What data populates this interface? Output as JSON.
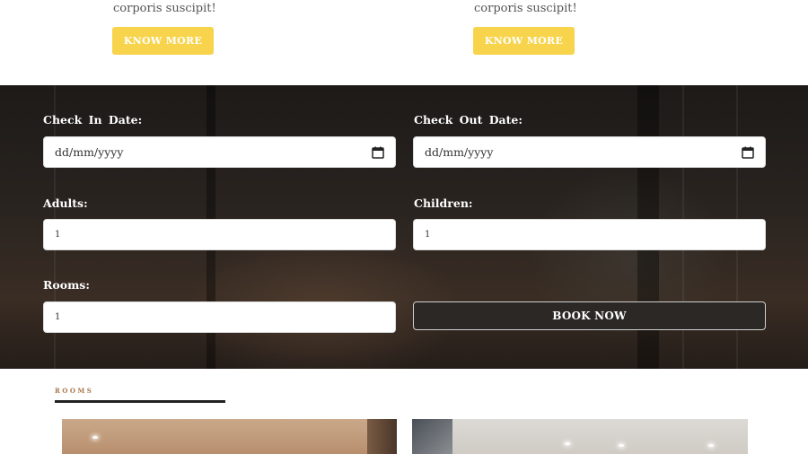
{
  "cards": [
    {
      "text_tail": "corporis suscipit!",
      "button": "KNOW MORE"
    },
    {
      "text_tail": "corporis suscipit!",
      "button": "KNOW MORE"
    }
  ],
  "booking": {
    "check_in_label": "Check In Date:",
    "check_in_placeholder": "dd/mm/yyyy",
    "check_out_label": "Check Out Date:",
    "check_out_placeholder": "dd/mm/yyyy",
    "adults_label": "Adults:",
    "adults_value": "1",
    "children_label": "Children:",
    "children_value": "1",
    "rooms_label": "Rooms:",
    "rooms_value": "1",
    "submit_label": "BOOK NOW"
  },
  "rooms_section": {
    "label": "ROOMS"
  },
  "colors": {
    "accent_button": "#f7d44c",
    "rooms_label": "#a8774b"
  },
  "icons": {
    "calendar": "calendar-icon"
  }
}
